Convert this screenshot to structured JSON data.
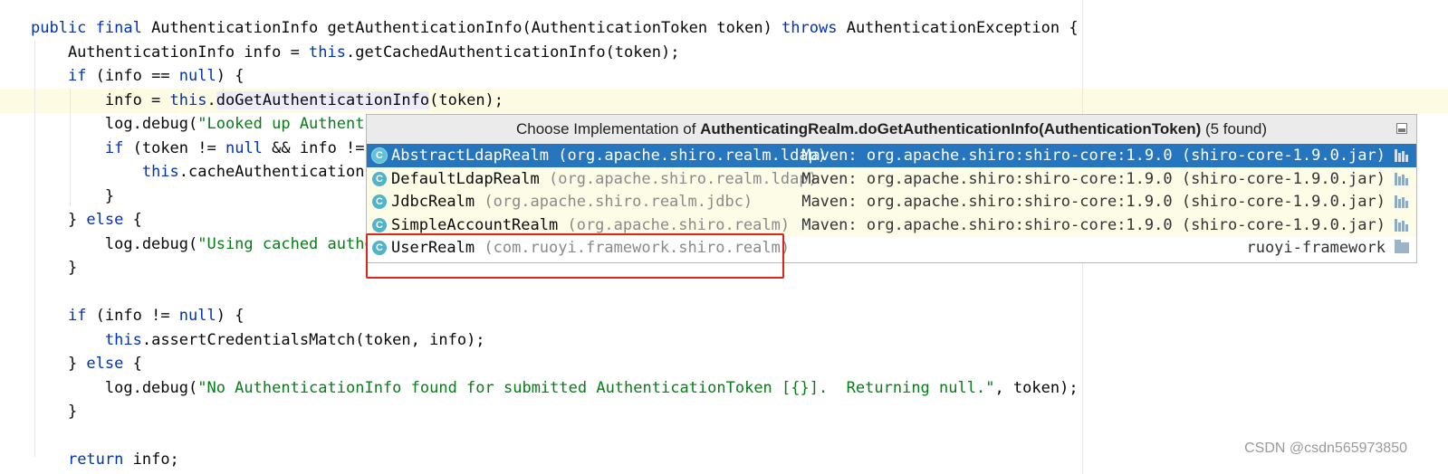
{
  "code": [
    {
      "text_parts": [
        {
          "t": "public final ",
          "c": "kw"
        },
        {
          "t": "AuthenticationInfo getAuthenticationInfo(AuthenticationToken token) "
        },
        {
          "t": "throws",
          "c": "kw"
        },
        {
          "t": " AuthenticationException {"
        }
      ]
    },
    {
      "text_parts": [
        {
          "t": "    AuthenticationInfo info = "
        },
        {
          "t": "this",
          "c": "kw"
        },
        {
          "t": ".getCachedAuthenticationInfo(token);"
        }
      ]
    },
    {
      "text_parts": [
        {
          "t": "    "
        },
        {
          "t": "if",
          "c": "kw"
        },
        {
          "t": " (info == "
        },
        {
          "t": "null",
          "c": "kw"
        },
        {
          "t": ") {"
        }
      ]
    },
    {
      "text_parts": [
        {
          "t": "        info = "
        },
        {
          "t": "this",
          "c": "kw"
        },
        {
          "t": "."
        },
        {
          "t": "doGetAuthenticationInfo",
          "c": "hl-usage"
        },
        {
          "t": "(token);"
        }
      ]
    },
    {
      "text_parts": [
        {
          "t": "        log.debug("
        },
        {
          "t": "\"Looked up Authenti",
          "c": "str"
        }
      ]
    },
    {
      "text_parts": [
        {
          "t": "        "
        },
        {
          "t": "if",
          "c": "kw"
        },
        {
          "t": " (token != "
        },
        {
          "t": "null",
          "c": "kw"
        },
        {
          "t": " && info != "
        }
      ]
    },
    {
      "text_parts": [
        {
          "t": "            "
        },
        {
          "t": "this",
          "c": "kw"
        },
        {
          "t": ".cacheAuthenticationI"
        }
      ]
    },
    {
      "text_parts": [
        {
          "t": "        }"
        }
      ]
    },
    {
      "text_parts": [
        {
          "t": "    } "
        },
        {
          "t": "else",
          "c": "kw"
        },
        {
          "t": " {"
        }
      ]
    },
    {
      "text_parts": [
        {
          "t": "        log.debug("
        },
        {
          "t": "\"Using cached authe",
          "c": "str"
        }
      ]
    },
    {
      "text_parts": [
        {
          "t": "    }"
        }
      ]
    },
    {
      "text_parts": []
    },
    {
      "text_parts": [
        {
          "t": "    "
        },
        {
          "t": "if",
          "c": "kw"
        },
        {
          "t": " (info != "
        },
        {
          "t": "null",
          "c": "kw"
        },
        {
          "t": ") {"
        }
      ]
    },
    {
      "text_parts": [
        {
          "t": "        "
        },
        {
          "t": "this",
          "c": "kw"
        },
        {
          "t": ".assertCredentialsMatch(token, info);"
        }
      ]
    },
    {
      "text_parts": [
        {
          "t": "    } "
        },
        {
          "t": "else",
          "c": "kw"
        },
        {
          "t": " {"
        }
      ]
    },
    {
      "text_parts": [
        {
          "t": "        log.debug("
        },
        {
          "t": "\"No AuthenticationInfo found for submitted AuthenticationToken [{}].  Returning null.\"",
          "c": "str"
        },
        {
          "t": ", token);"
        }
      ]
    },
    {
      "text_parts": [
        {
          "t": "    }"
        }
      ]
    },
    {
      "text_parts": []
    },
    {
      "text_parts": [
        {
          "t": "    "
        },
        {
          "t": "return",
          "c": "kw"
        },
        {
          "t": " info;"
        }
      ]
    }
  ],
  "popup": {
    "title_prefix": "Choose Implementation of ",
    "title_bold": "AuthenticatingRealm.doGetAuthenticationInfo(AuthenticationToken)",
    "title_suffix": " (5 found)",
    "pin_icon": "pin-icon",
    "items": [
      {
        "name": "AbstractLdapRealm",
        "package": " (org.apache.shiro.realm.ldap)",
        "source": "Maven: org.apache.shiro:shiro-core:1.9.0 (shiro-core-1.9.0.jar)",
        "icon": "abstract-class-icon",
        "source_icon": "library-icon",
        "selected": true,
        "library": true
      },
      {
        "name": "DefaultLdapRealm",
        "package": " (org.apache.shiro.realm.ldap)",
        "source": "Maven: org.apache.shiro:shiro-core:1.9.0 (shiro-core-1.9.0.jar)",
        "icon": "class-icon",
        "source_icon": "library-icon",
        "selected": false,
        "library": true
      },
      {
        "name": "JdbcRealm",
        "package": " (org.apache.shiro.realm.jdbc)",
        "source": "Maven: org.apache.shiro:shiro-core:1.9.0 (shiro-core-1.9.0.jar)",
        "icon": "class-icon",
        "source_icon": "library-icon",
        "selected": false,
        "library": true
      },
      {
        "name": "SimpleAccountRealm",
        "package": " (org.apache.shiro.realm)",
        "source": "Maven: org.apache.shiro:shiro-core:1.9.0 (shiro-core-1.9.0.jar)",
        "icon": "class-icon",
        "source_icon": "library-icon",
        "selected": false,
        "library": true
      },
      {
        "name": "UserRealm",
        "package": " (com.ruoyi.framework.shiro.realm)",
        "source": "ruoyi-framework",
        "icon": "class-icon",
        "source_icon": "module-icon",
        "selected": false,
        "library": false
      }
    ]
  },
  "watermark": "CSDN @csdn565973850",
  "colors": {
    "selection": "#2675bf",
    "keyword": "#0033b3",
    "string": "#067d17",
    "highlight_box": "#e0241b"
  }
}
